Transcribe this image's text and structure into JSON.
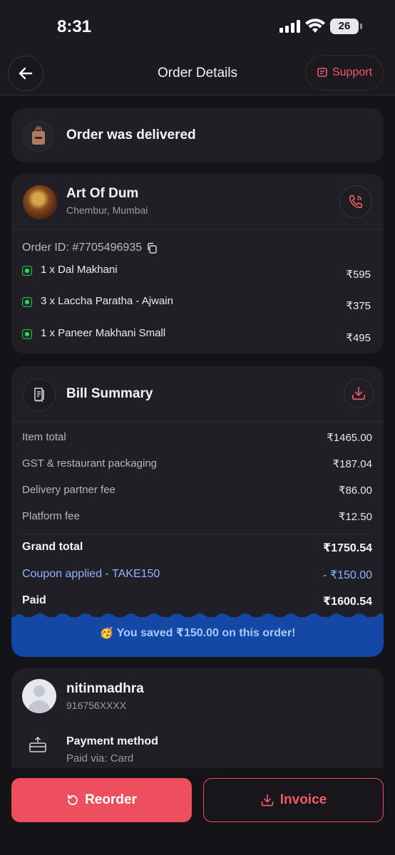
{
  "status_bar": {
    "time": "8:31",
    "battery": "26"
  },
  "header": {
    "title": "Order Details",
    "back_icon": "arrow-left-icon",
    "support_label": "Support"
  },
  "delivery": {
    "status": "Order was delivered"
  },
  "restaurant": {
    "name": "Art Of Dum",
    "location": "Chembur, Mumbai",
    "order_id": "Order ID: #7705496935",
    "items": [
      {
        "name": "1 x Dal Makhani",
        "price": "₹595"
      },
      {
        "name": "3 x Laccha Paratha - Ajwain",
        "price": "₹375"
      },
      {
        "name": "1 x Paneer Makhani Small",
        "price": "₹495"
      }
    ]
  },
  "bill": {
    "title": "Bill Summary",
    "rows": [
      {
        "label": "Item total",
        "value": "₹1465.00"
      },
      {
        "label": "GST & restaurant packaging",
        "value": "₹187.04"
      },
      {
        "label": "Delivery partner fee",
        "value": "₹86.00"
      },
      {
        "label": "Platform fee",
        "value": "₹12.50"
      }
    ],
    "grand_total": {
      "label": "Grand total",
      "value": "₹1750.54"
    },
    "coupon": {
      "label": "Coupon applied - TAKE150",
      "value": "- ₹150.00"
    },
    "paid": {
      "label": "Paid",
      "value": "₹1600.54"
    },
    "savings": "You saved ₹150.00 on this order!"
  },
  "user": {
    "name": "nitinmadhra",
    "phone": "916756XXXX",
    "payment_title": "Payment method",
    "payment_detail": "Paid via: Card"
  },
  "actions": {
    "reorder_label": "Reorder",
    "invoice_label": "Invoice"
  },
  "colors": {
    "accent": "#ee4f5e",
    "savings_band": "#1448a6",
    "coupon_text": "#8fb4ff",
    "veg": "#37d468"
  }
}
